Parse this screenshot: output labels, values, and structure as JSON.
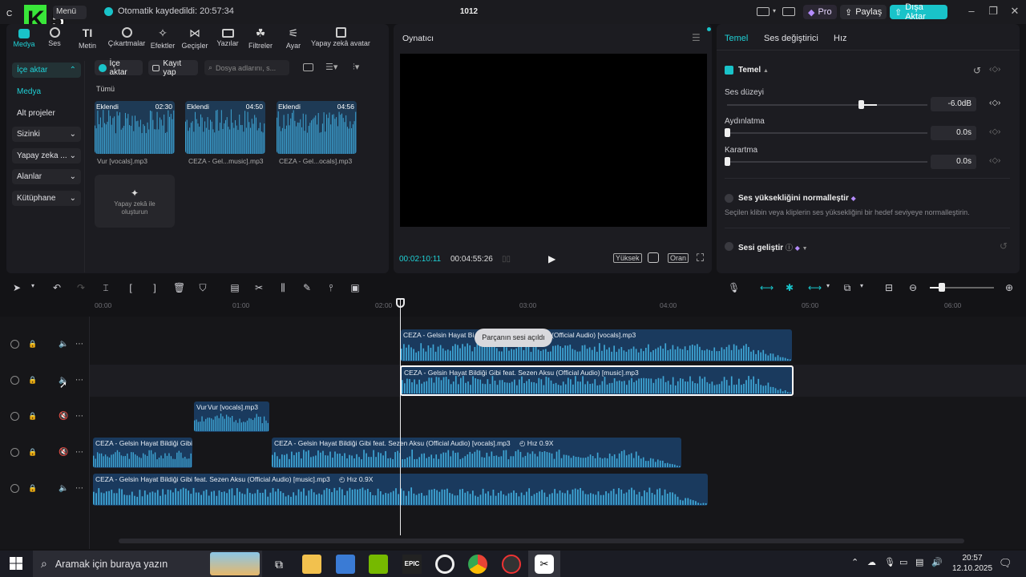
{
  "titlebar": {
    "menu_label": "Menü",
    "autosave_text": "Otomatik kaydedildi: 20:57:34",
    "project_name": "1012",
    "pro_label": "Pro",
    "share_label": "Paylaş",
    "export_label": "Dışa Aktar",
    "accent": "#19c3c9"
  },
  "toolbar": {
    "tools": [
      "Medya",
      "Ses",
      "Metin",
      "Çıkartmalar",
      "Efektler",
      "Geçişler",
      "Yazılar",
      "Filtreler",
      "Ayar",
      "Yapay zekâ avatar"
    ],
    "active": "Medya"
  },
  "sidebar": {
    "items": [
      "İçe aktar",
      "Medya",
      "Alt projeler",
      "Sizinki",
      "Yapay zeka ...",
      "Alanlar",
      "Kütüphane"
    ]
  },
  "media": {
    "import_label": "İçe aktar",
    "record_label": "Kayıt yap",
    "search_placeholder": "Dosya adlarını, s...",
    "filter_label": "Tümü",
    "cards": [
      {
        "badge": "Eklendi",
        "duration": "02:30",
        "name": "Vur [vocals].mp3"
      },
      {
        "badge": "Eklendi",
        "duration": "04:50",
        "name": "CEZA - Gel...music].mp3"
      },
      {
        "badge": "Eklendi",
        "duration": "04:56",
        "name": "CEZA - Gel...ocals].mp3"
      }
    ],
    "ai_card_label": "Yapay zekâ ile oluşturun"
  },
  "player": {
    "title": "Oynatıcı",
    "current_time": "00:02:10:11",
    "total_time": "00:04:55:26",
    "quality_label": "Yüksek",
    "ratio_label": "Oran"
  },
  "props": {
    "tabs": [
      "Temel",
      "Ses değiştirici",
      "Hız"
    ],
    "section": "Temel",
    "volume_label": "Ses düzeyi",
    "volume_value": "-6.0dB",
    "fadein_label": "Aydınlatma",
    "fadein_value": "0.0s",
    "fadeout_label": "Karartma",
    "fadeout_value": "0.0s",
    "normalize_label": "Ses yüksekliğini normalleştir",
    "normalize_desc": "Seçilen klibin veya kliplerin ses yüksekliğini bir hedef seviyeye normalleştirin.",
    "enhance_label": "Sesi geliştir"
  },
  "ruler": {
    "ticks": [
      "00:00",
      "01:00",
      "02:00",
      "03:00",
      "04:00",
      "05:00",
      "06:00"
    ]
  },
  "timeline": {
    "tooltip": "Parçanın sesi açıldı",
    "clips": [
      {
        "title": "CEZA - Gelsin Hayat Bi",
        "title2": "(Official Audio) [vocals].mp3"
      },
      {
        "title": "CEZA - Gelsin Hayat Bildiği Gibi feat. Sezen Aksu (Official Audio) [music].mp3"
      },
      {
        "title": "Vur",
        "title2": "Vur [vocals].mp3"
      },
      {
        "title": "CEZA - Gelsin Hayat Bildiği Gibi"
      },
      {
        "title": "CEZA - Gelsin Hayat Bildiği Gibi feat. Sezen Aksu (Official Audio) [vocals].mp3",
        "speed": "Hız 0.9X"
      },
      {
        "title": "CEZA - Gelsin Hayat Bildiği Gibi feat. Sezen Aksu (Official Audio) [music].mp3",
        "speed": "Hız 0.9X"
      }
    ]
  },
  "taskbar": {
    "search_placeholder": "Aramak için buraya yazın",
    "time": "20:57",
    "date": "12.10.2025"
  }
}
